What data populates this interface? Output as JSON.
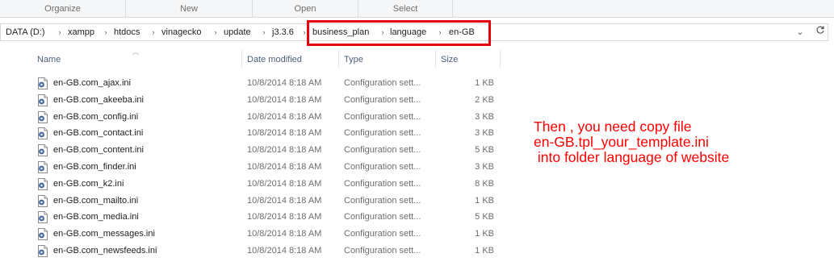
{
  "ribbon": {
    "groups": [
      "Organize",
      "New",
      "Open",
      "Select"
    ]
  },
  "address": {
    "crumbs": [
      "DATA (D:)",
      "xampp",
      "htdocs",
      "vinagecko",
      "update",
      "j3.3.6",
      "business_plan",
      "language",
      "en-GB"
    ],
    "dropdown_icon": "chevron-down-icon",
    "refresh_icon": "refresh-icon"
  },
  "columns": {
    "name": "Name",
    "date": "Date modified",
    "type": "Type",
    "size": "Size"
  },
  "files": [
    {
      "name": "en-GB.com_ajax.ini",
      "date": "10/8/2014 8:18 AM",
      "type": "Configuration sett...",
      "size": "1 KB"
    },
    {
      "name": "en-GB.com_akeeba.ini",
      "date": "10/8/2014 8:18 AM",
      "type": "Configuration sett...",
      "size": "2 KB"
    },
    {
      "name": "en-GB.com_config.ini",
      "date": "10/8/2014 8:18 AM",
      "type": "Configuration sett...",
      "size": "3 KB"
    },
    {
      "name": "en-GB.com_contact.ini",
      "date": "10/8/2014 8:18 AM",
      "type": "Configuration sett...",
      "size": "3 KB"
    },
    {
      "name": "en-GB.com_content.ini",
      "date": "10/8/2014 8:18 AM",
      "type": "Configuration sett...",
      "size": "5 KB"
    },
    {
      "name": "en-GB.com_finder.ini",
      "date": "10/8/2014 8:18 AM",
      "type": "Configuration sett...",
      "size": "3 KB"
    },
    {
      "name": "en-GB.com_k2.ini",
      "date": "10/8/2014 8:18 AM",
      "type": "Configuration sett...",
      "size": "8 KB"
    },
    {
      "name": "en-GB.com_mailto.ini",
      "date": "10/8/2014 8:18 AM",
      "type": "Configuration sett...",
      "size": "1 KB"
    },
    {
      "name": "en-GB.com_media.ini",
      "date": "10/8/2014 8:18 AM",
      "type": "Configuration sett...",
      "size": "5 KB"
    },
    {
      "name": "en-GB.com_messages.ini",
      "date": "10/8/2014 8:18 AM",
      "type": "Configuration sett...",
      "size": "1 KB"
    },
    {
      "name": "en-GB.com_newsfeeds.ini",
      "date": "10/8/2014 8:18 AM",
      "type": "Configuration sett...",
      "size": "1 KB"
    }
  ],
  "annotation": {
    "text": "Then , you need copy file\nen-GB.tpl_your_template.ini\n into folder language of website",
    "color": "#ff0000"
  },
  "colors": {
    "highlight_box": "#e8000b",
    "header_text": "#4c607a"
  }
}
